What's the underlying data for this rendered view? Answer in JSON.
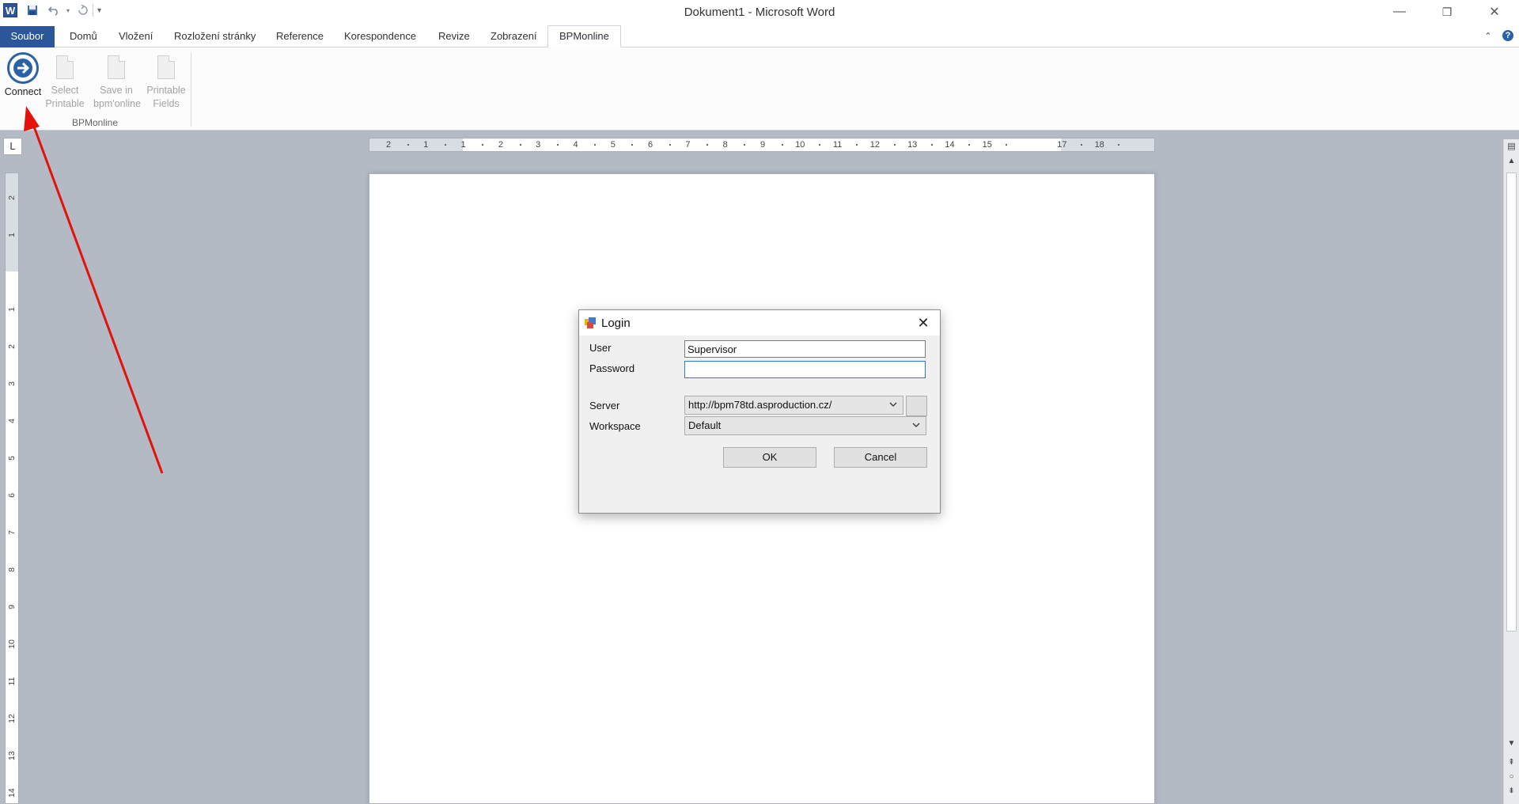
{
  "window": {
    "title": "Dokument1 - Microsoft Word",
    "minimize_glyph": "—",
    "restore_glyph": "❐",
    "close_glyph": "✕"
  },
  "app_icon_letter": "W",
  "quick_access": {
    "save": "save-icon",
    "undo": "undo-icon",
    "redo": "redo-icon",
    "customize": "customize-icon"
  },
  "tabs": {
    "file": "Soubor",
    "home": "Domů",
    "insert": "Vložení",
    "layout": "Rozložení stránky",
    "references": "Reference",
    "mailings": "Korespondence",
    "review": "Revize",
    "view": "Zobrazení",
    "bpmonline": "BPMonline"
  },
  "ribbon": {
    "connect": "Connect",
    "select_printable_1": "Select",
    "select_printable_2": "Printable",
    "save_bpm_1": "Save in",
    "save_bpm_2": "bpm'online",
    "printable_fields_1": "Printable",
    "printable_fields_2": "Fields",
    "group_label": "BPMonline"
  },
  "ruler": {
    "corner": "L",
    "h_labels": [
      "2",
      "1",
      "1",
      "2",
      "3",
      "4",
      "5",
      "6",
      "7",
      "8",
      "9",
      "10",
      "11",
      "12",
      "13",
      "14",
      "15",
      "17",
      "18"
    ],
    "v_labels": [
      "2",
      "1",
      "1",
      "2",
      "3",
      "4",
      "5",
      "6",
      "7",
      "8",
      "9",
      "10",
      "11",
      "12",
      "13",
      "14"
    ]
  },
  "dialog": {
    "title": "Login",
    "user_label": "User",
    "user_value": "Supervisor",
    "password_label": "Password",
    "password_value": "",
    "server_label": "Server",
    "server_value": "http://bpm78td.asproduction.cz/",
    "workspace_label": "Workspace",
    "workspace_value": "Default",
    "ok": "OK",
    "cancel": "Cancel",
    "close_glyph": "✕"
  },
  "colors": {
    "accent": "#2b579a",
    "annotation_arrow": "#e3120b",
    "focus": "#2c78d6"
  }
}
